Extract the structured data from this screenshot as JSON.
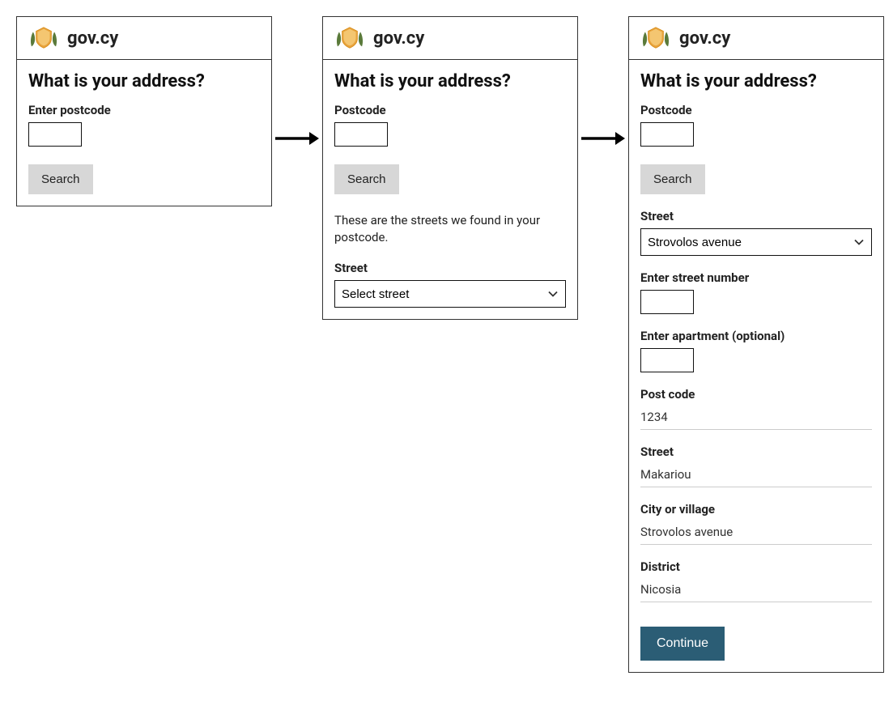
{
  "brand": "gov.cy",
  "heading": "What is your address?",
  "step1": {
    "postcode_label": "Enter postcode",
    "search_label": "Search"
  },
  "step2": {
    "postcode_label": "Postcode",
    "search_label": "Search",
    "info_text": "These are the streets we found in your postcode.",
    "street_label": "Street",
    "street_placeholder": "Select street"
  },
  "step3": {
    "postcode_label": "Postcode",
    "search_label": "Search",
    "street_label": "Street",
    "street_selected": "Strovolos avenue",
    "street_number_label": "Enter street number",
    "apartment_label": "Enter apartment (optional)",
    "postcode_display_label": "Post code",
    "postcode_display_value": "1234",
    "street_display_label": "Street",
    "street_display_value": "Makariou",
    "city_label": "City or village",
    "city_value": "Strovolos avenue",
    "district_label": "District",
    "district_value": "Nicosia",
    "continue_label": "Continue"
  }
}
